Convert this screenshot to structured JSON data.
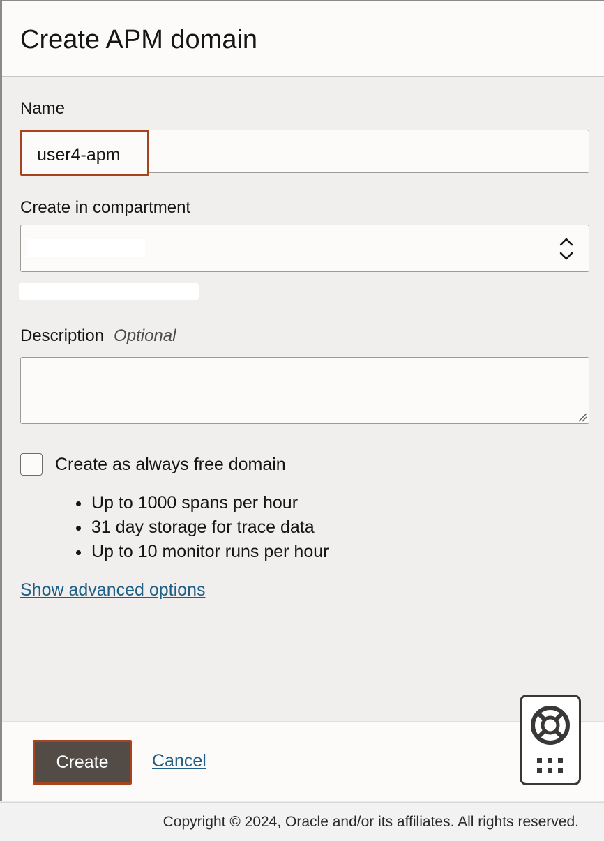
{
  "dialog": {
    "title": "Create APM domain"
  },
  "form": {
    "name_label": "Name",
    "name_value": "user4-apm",
    "compartment_label": "Create in compartment",
    "description_label": "Description",
    "description_optional": "Optional",
    "description_value": "",
    "always_free_label": "Create as always free domain",
    "always_free_checked": false,
    "always_free_features": [
      "Up to 1000 spans per hour",
      "31 day storage for trace data",
      "Up to 10 monitor runs per hour"
    ],
    "advanced_link": "Show advanced options"
  },
  "footer": {
    "create_label": "Create",
    "cancel_label": "Cancel"
  },
  "help_widget": {
    "icon": "lifebuoy-icon",
    "grid_icon": "grid-dots-icon"
  },
  "page_footer": {
    "copyright": "Copyright © 2024, Oracle and/or its affiliates. All rights reserved."
  },
  "colors": {
    "accent_border": "#a5441d",
    "primary_button": "#524b46",
    "link": "#1f5f86"
  }
}
